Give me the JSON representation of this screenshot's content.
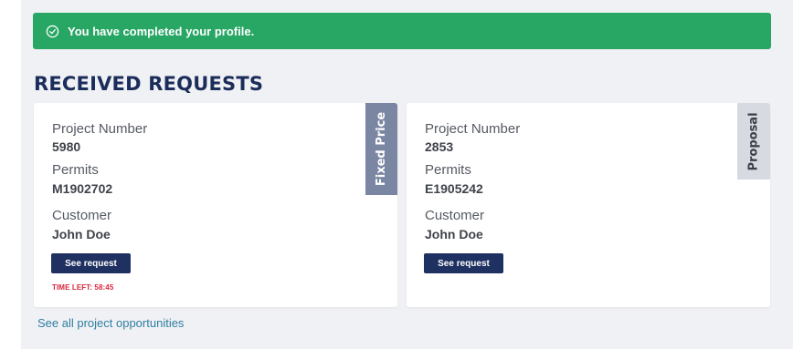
{
  "alert": {
    "message": "You have completed your profile.",
    "icon": "check-circle-icon",
    "color": "#27a664"
  },
  "section": {
    "title": "RECEIVED REQUESTS"
  },
  "cards": [
    {
      "project_label": "Project Number",
      "project_number": "5980",
      "permits_label": "Permits",
      "permits_value": "M1902702",
      "customer_label": "Customer",
      "customer_value": "John Doe",
      "button_label": "See request",
      "time_left": "TIME LEFT: 58:45",
      "tag": "Fixed Price"
    },
    {
      "project_label": "Project Number",
      "project_number": "2853",
      "permits_label": "Permits",
      "permits_value": "E1905242",
      "customer_label": "Customer",
      "customer_value": "John Doe",
      "button_label": "See request",
      "tag": "Proposal"
    }
  ],
  "footer": {
    "link_label": "See all project opportunities"
  },
  "colors": {
    "brand_navy": "#1b2d5b",
    "button": "#1f3161",
    "danger": "#d7263d",
    "link": "#2e7fa3"
  }
}
